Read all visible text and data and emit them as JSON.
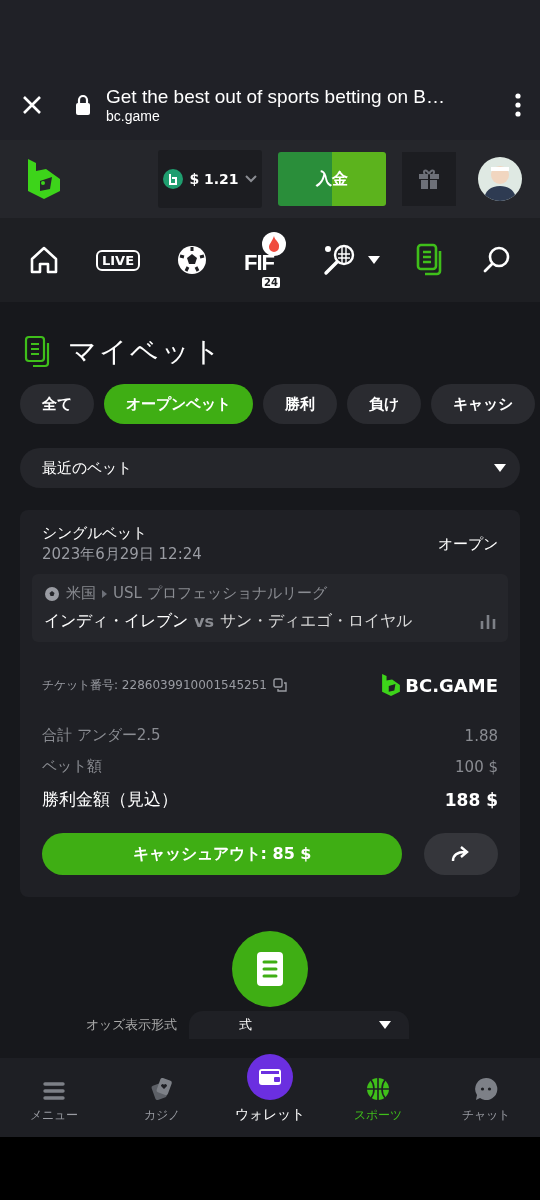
{
  "browser": {
    "title": "Get the best out of sports betting on B…",
    "url": "bc.game"
  },
  "header": {
    "balance": "$ 1.21",
    "deposit": "入金"
  },
  "sports_nav": [
    {
      "kind": "home",
      "selected": false
    },
    {
      "kind": "live",
      "label": "LIVE",
      "selected": false
    },
    {
      "kind": "soccer",
      "selected": false
    },
    {
      "kind": "fifa",
      "label": "FIF",
      "sub": "24",
      "selected": false
    },
    {
      "kind": "tennis",
      "selected": false
    },
    {
      "kind": "mybets",
      "selected": true
    },
    {
      "kind": "search",
      "selected": false
    }
  ],
  "page_title": "マイベット",
  "filters": [
    {
      "label": "全て",
      "selected": false
    },
    {
      "label": "オープンベット",
      "selected": true
    },
    {
      "label": "勝利",
      "selected": false
    },
    {
      "label": "負け",
      "selected": false
    },
    {
      "label": "キャッシ",
      "selected": false
    }
  ],
  "period_select": {
    "value": "最近のベット"
  },
  "bet": {
    "type": "シングルベット",
    "date": "2023年6月29日 12:24",
    "status": "オープン",
    "country": "米国",
    "league": "USL プロフェッショナルリーグ",
    "home": "インディ・イレブン",
    "vs": "vs",
    "away": "サン・ディエゴ・ロイヤル",
    "ticket": "チケット番号: 2286039910001545251",
    "brand": "BC.GAME",
    "rows": [
      {
        "label": "合計 アンダー2.5",
        "value": "1.88",
        "kind": "plain"
      },
      {
        "label": "ベット額",
        "value": "100 $",
        "kind": "plain"
      },
      {
        "label": "勝利金額（見込）",
        "value": "188 $",
        "kind": "total"
      }
    ],
    "cashout": "キャッシュアウト: 85 $"
  },
  "odds_format": {
    "label": "オッズ表示形式",
    "value": "式"
  },
  "bottom_nav": [
    {
      "kind": "menu",
      "label": "メニュー",
      "selected": false
    },
    {
      "kind": "casino",
      "label": "カジノ",
      "selected": false
    },
    {
      "kind": "wallet",
      "label": "ウォレット",
      "selected": false
    },
    {
      "kind": "sports",
      "label": "スポーツ",
      "selected": true
    },
    {
      "kind": "chat",
      "label": "チャット",
      "selected": false
    }
  ]
}
